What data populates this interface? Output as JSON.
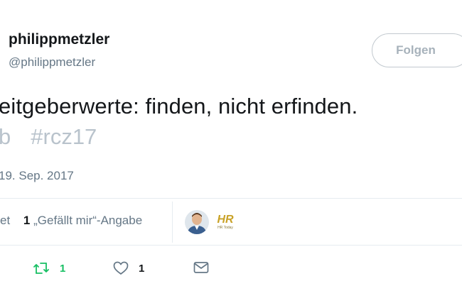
{
  "user": {
    "display_name": "philippmetzler",
    "handle": "@philippmetzler"
  },
  "follow_button": {
    "label": "Folgen"
  },
  "tweet": {
    "line1": "eitgeberwerte: finden, nicht erfinden.",
    "line2_fragment": "b",
    "hashtag": "#rcz17",
    "timestamp": "19. Sep. 2017"
  },
  "stats": {
    "retweets_partial_label": "et",
    "likes_count": "1",
    "likes_label": "„Gefällt mir“-Angabe",
    "liker_avatars": [
      {
        "icon": "person-avatar"
      },
      {
        "icon": "hr-today-logo",
        "logo_text": "HR",
        "logo_subtext": "HR Today"
      }
    ]
  },
  "actions": {
    "retweet": {
      "icon": "retweet-icon",
      "count": "1",
      "color": "#17bf63"
    },
    "like": {
      "icon": "heart-icon",
      "count": "1",
      "color": "#657786"
    },
    "message": {
      "icon": "envelope-icon",
      "color": "#657786"
    }
  },
  "colors": {
    "primary_text": "#14171a",
    "secondary_text": "#657786",
    "muted_hashtag": "#b9c3cc",
    "divider": "#e6ecf0",
    "retweet_green": "#17bf63",
    "hr_logo_gold": "#c9a227"
  }
}
